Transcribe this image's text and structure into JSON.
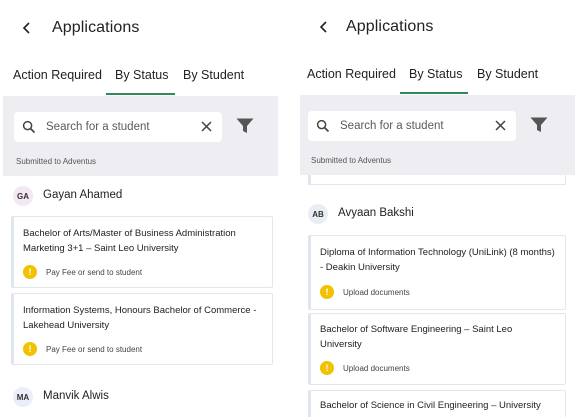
{
  "header": {
    "title": "Applications"
  },
  "tabs": [
    {
      "label": "Action Required"
    },
    {
      "label": "By Status"
    },
    {
      "label": "By Student"
    }
  ],
  "search": {
    "placeholder": "Search for a student"
  },
  "section_label": "Submitted to Adventus",
  "colors": {
    "accent": "#2e8b57",
    "warning": "#f2c200",
    "search_bg": "#eeeef2"
  },
  "left": {
    "students": [
      {
        "initials": "GA",
        "name": "Gayan Ahamed",
        "applications": [
          {
            "title": "Bachelor of Arts/Master of Business Administration Marketing 3+1 – Saint Leo University",
            "status": "Pay Fee or send to student"
          },
          {
            "title": "Information Systems, Honours Bachelor of Commerce - Lakehead University",
            "status": "Pay Fee or send to student"
          }
        ]
      },
      {
        "initials": "MA",
        "name": "Manvik Alwis"
      }
    ]
  },
  "right": {
    "students": [
      {
        "initials": "AB",
        "name": "Avyaan Bakshi",
        "applications": [
          {
            "title": "Diploma of Information Technology (UniLink) (8 months) - Deakin University",
            "status": "Upload documents"
          },
          {
            "title": "Bachelor of Software Engineering – Saint Leo University",
            "status": "Upload documents"
          },
          {
            "title": "Bachelor of Science in Civil Engineering – University"
          }
        ]
      }
    ]
  }
}
